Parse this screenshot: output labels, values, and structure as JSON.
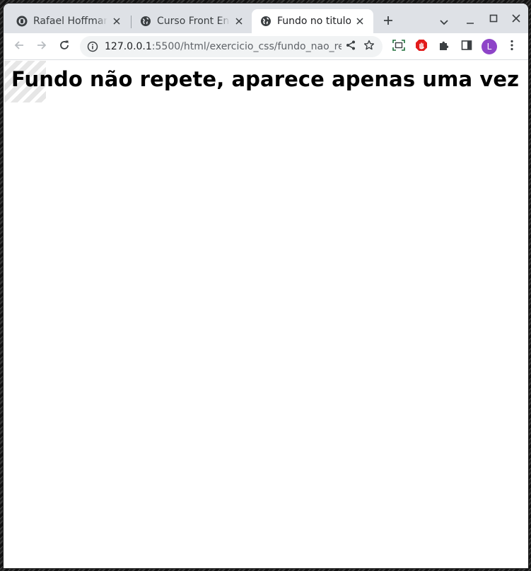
{
  "browser": {
    "tabs": [
      {
        "title": "Rafael Hoffman",
        "favicon": "github-icon",
        "active": false
      },
      {
        "title": "Curso Front End",
        "favicon": "globe-icon",
        "active": false
      },
      {
        "title": "Fundo no titulo",
        "favicon": "globe-icon",
        "active": true
      }
    ],
    "address_bar": {
      "url_host": "127.0.0.1",
      "url_rest": ":5500/html/exercicio_css/fundo_nao_re..."
    },
    "profile_initial": "L",
    "icons": {
      "back": "arrow-left-icon",
      "forward": "arrow-right-icon",
      "reload": "reload-icon",
      "site_info": "info-icon",
      "share": "share-icon",
      "bookmark": "star-icon",
      "screenshot": "screen-capture-icon",
      "adblock": "stop-hand-icon",
      "extensions": "puzzle-icon",
      "side_panel": "side-panel-icon",
      "menu": "kebab-menu-icon",
      "new_tab": "plus-icon",
      "tab_search": "chevron-down-icon",
      "minimize": "minimize-icon",
      "maximize": "maximize-icon",
      "close": "close-icon"
    },
    "colors": {
      "tab_strip": "#dee1e6",
      "omnibox": "#f1f3f4",
      "avatar": "#8e44c8",
      "adblock": "#e21b1b"
    }
  },
  "page": {
    "heading": "Fundo não repete, aparece apenas uma vez"
  }
}
